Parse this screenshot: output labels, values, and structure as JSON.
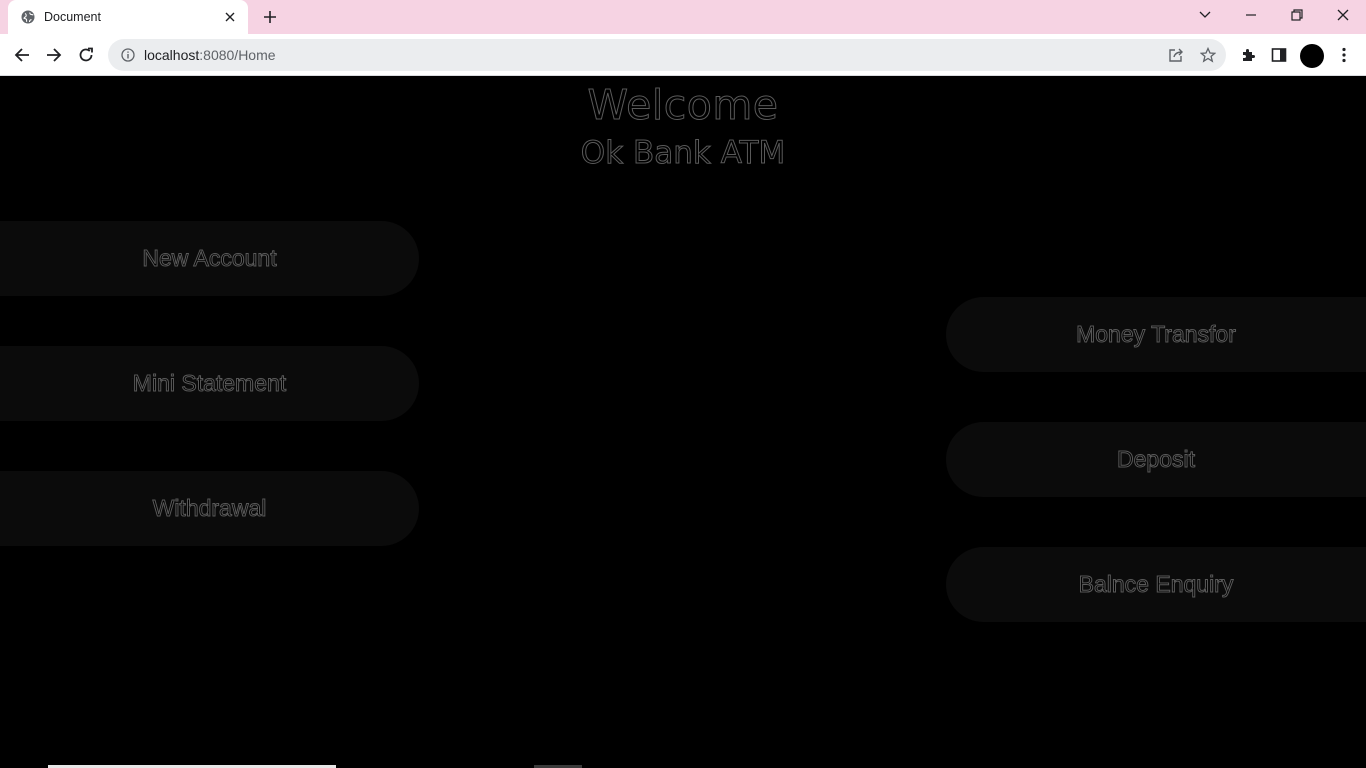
{
  "browser": {
    "tab_title": "Document",
    "url_host": "localhost",
    "url_rest": ":8080/Home"
  },
  "page": {
    "welcome": "Welcome",
    "bank_name": "Ok Bank ATM",
    "left_buttons": [
      "New Account",
      "Mini Statement",
      "Withdrawal"
    ],
    "right_buttons": [
      "Money Transfor",
      "Deposit",
      "Balnce Enquiry"
    ]
  },
  "colors": {
    "tabbar_bg": "#f6d3e3",
    "page_bg": "#000000",
    "button_bg": "#0b0b0b",
    "text_outline": "#5a5a5a"
  }
}
